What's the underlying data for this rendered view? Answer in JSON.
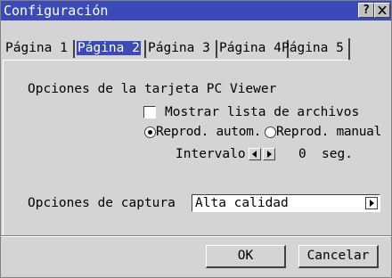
{
  "window": {
    "title": "Configuración",
    "help_label": "?"
  },
  "tabs": [
    {
      "label": "Página 1",
      "active": false
    },
    {
      "label": "Página 2",
      "active": true
    },
    {
      "label": "Página 3",
      "active": false
    },
    {
      "label": "Página 4",
      "active": false
    },
    {
      "label": "Página 5",
      "active": false
    }
  ],
  "viewer": {
    "section_label": "Opciones de la tarjeta PC Viewer",
    "show_files_label": "Mostrar lista de archivos",
    "show_files_checked": false,
    "radio_auto_label": "Reprod. autom.",
    "radio_manual_label": "Reprod. manual",
    "selected_mode": "auto",
    "interval_label": "Intervalo",
    "interval_value": "0",
    "interval_unit": "seg."
  },
  "capture": {
    "label": "Opciones de captura",
    "value": "Alta calidad"
  },
  "buttons": {
    "ok": "OK",
    "cancel": "Cancelar"
  },
  "colors": {
    "title_bar": "#3a4ab8",
    "background": "#d4d4d4"
  }
}
